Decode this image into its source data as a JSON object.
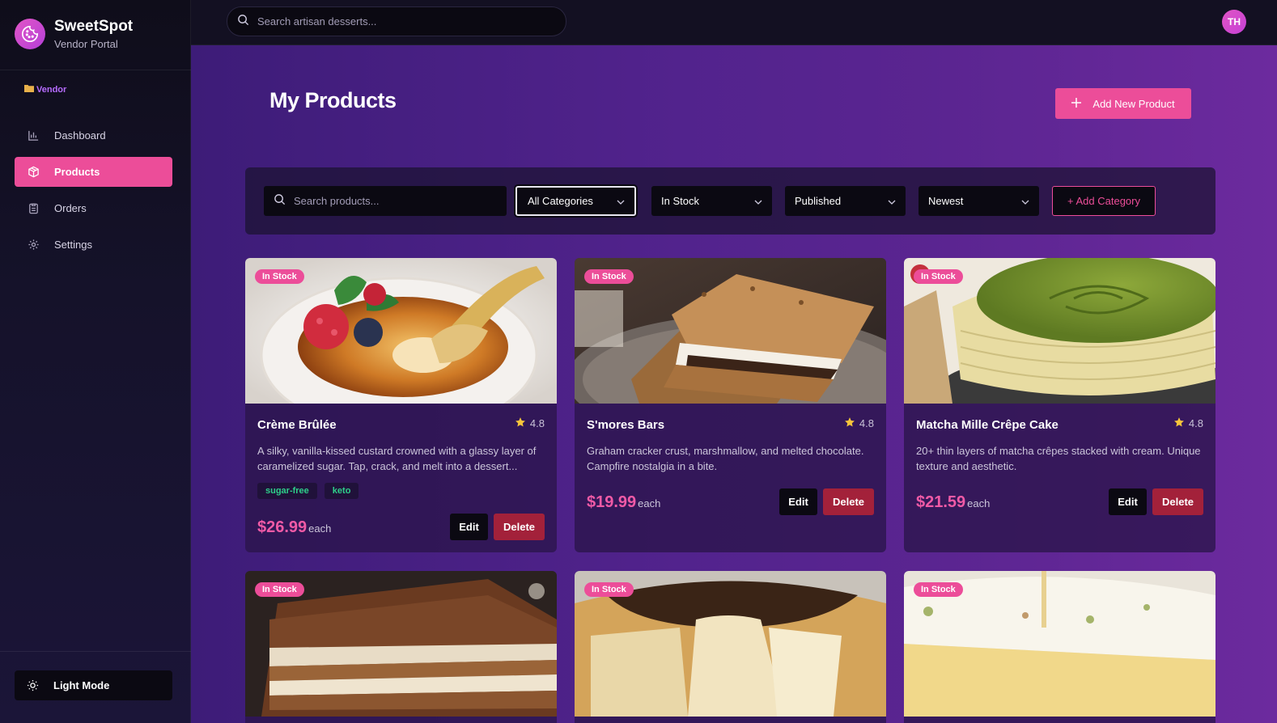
{
  "app": {
    "name": "SweetSpot",
    "subtitle": "Vendor Portal",
    "role": "Vendor"
  },
  "sidebar": {
    "items": [
      {
        "label": "Dashboard",
        "icon": "bar-chart-icon"
      },
      {
        "label": "Products",
        "icon": "box-icon",
        "active": true
      },
      {
        "label": "Orders",
        "icon": "clipboard-icon"
      },
      {
        "label": "Settings",
        "icon": "gear-icon"
      }
    ],
    "theme_toggle": "Light Mode"
  },
  "topbar": {
    "search_placeholder": "Search artisan desserts...",
    "avatar_initials": "TH"
  },
  "page": {
    "title": "My Products",
    "add_button": "Add New Product"
  },
  "filters": {
    "search_placeholder": "Search products...",
    "category": "All Categories",
    "stock": "In Stock",
    "status": "Published",
    "sort": "Newest",
    "add_category": "+ Add Category"
  },
  "products": [
    {
      "badge": "In Stock",
      "name": "Crème Brûlée",
      "rating": "4.8",
      "description": "A silky, vanilla-kissed custard crowned with a glassy layer of caramelized sugar. Tap, crack, and melt into a dessert...",
      "tags": [
        "sugar-free",
        "keto"
      ],
      "price": "$26.99",
      "unit": "each",
      "edit": "Edit",
      "delete": "Delete"
    },
    {
      "badge": "In Stock",
      "name": "S'mores Bars",
      "rating": "4.8",
      "description": "Graham cracker crust, marshmallow, and melted chocolate. Campfire nostalgia in a bite.",
      "tags": [],
      "price": "$19.99",
      "unit": "each",
      "edit": "Edit",
      "delete": "Delete"
    },
    {
      "badge": "In Stock",
      "name": "Matcha Mille Crêpe Cake",
      "rating": "4.8",
      "description": "20+ thin layers of matcha crêpes stacked with cream. Unique texture and aesthetic.",
      "tags": [],
      "price": "$21.59",
      "unit": "each",
      "edit": "Edit",
      "delete": "Delete"
    },
    {
      "badge": "In Stock"
    },
    {
      "badge": "In Stock"
    },
    {
      "badge": "In Stock"
    }
  ],
  "colors": {
    "accent": "#ec4d99",
    "danger": "#a3213a",
    "tag": "#2ecf8a",
    "star": "#f7c53b"
  }
}
